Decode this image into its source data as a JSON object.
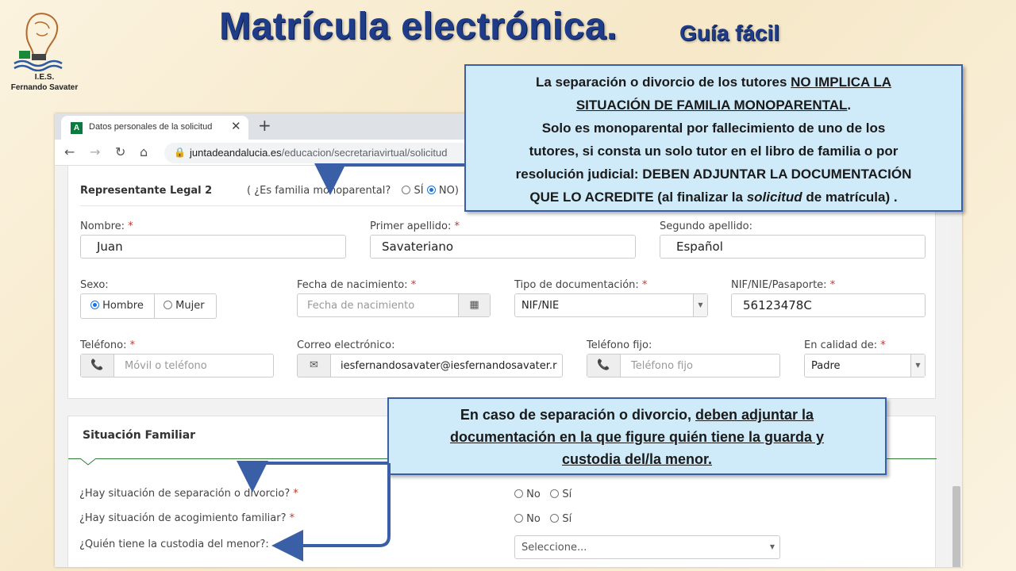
{
  "header": {
    "title": "Matrícula electrónica.",
    "subtitle": "Guía fácil",
    "logo_line1": "I.E.S.",
    "logo_line2": "Fernando Savater"
  },
  "browser": {
    "tab_title": "Datos personales de la solicitud",
    "favicon_letter": "A",
    "url_host": "juntadeandalucia.es",
    "url_path": "/educacion/secretariavirtual/solicitud"
  },
  "representante": {
    "section_title": "Representante Legal 2",
    "monoparental_question_open": "( ¿Es familia monoparental?",
    "opt_si": "SÍ",
    "opt_no": "NO)",
    "selected": "NO",
    "nombre_label": "Nombre:",
    "nombre_value": "Juan",
    "apellido1_label": "Primer apellido:",
    "apellido1_value": "Savateriano",
    "apellido2_label": "Segundo apellido:",
    "apellido2_value": "Español",
    "sexo_label": "Sexo:",
    "sexo_hombre": "Hombre",
    "sexo_mujer": "Mujer",
    "sexo_selected": "Hombre",
    "fecha_label": "Fecha de nacimiento:",
    "fecha_placeholder": "Fecha de nacimiento",
    "tipodoc_label": "Tipo de documentación:",
    "tipodoc_value": "NIF/NIE",
    "nif_label": "NIF/NIE/Pasaporte:",
    "nif_value": "56123478C",
    "telefono_label": "Teléfono:",
    "telefono_placeholder": "Móvil o teléfono",
    "correo_label": "Correo electrónico:",
    "correo_value": "iesfernandosavater@iesfernandosavater.r",
    "tfijo_label": "Teléfono fijo:",
    "tfijo_placeholder": "Teléfono fijo",
    "calidad_label": "En calidad de:",
    "calidad_value": "Padre",
    "required_mark": "*"
  },
  "situacion": {
    "section_title": "Situación Familiar",
    "q_separacion": "¿Hay situación de separación o divorcio?",
    "q_acogimiento": "¿Hay situación de acogimiento familiar?",
    "q_custodia": "¿Quién tiene la custodia del menor?:",
    "opt_no": "No",
    "opt_si": "Sí",
    "custodia_placeholder": "Seleccione..."
  },
  "callout1": {
    "l1a": "La separación o divorcio de los tutores ",
    "l1b": "NO IMPLICA LA",
    "l2a": "SITUACIÓN DE FAMILIA MONOPARENTAL",
    "l2b": ".",
    "l3": "Solo es monoparental por fallecimiento de uno de los",
    "l4": "tutores, si consta un solo tutor en el libro de familia o por",
    "l5": "resolución judicial: DEBEN ADJUNTAR LA DOCUMENTACIÓN",
    "l6a": "QUE LO ACREDITE (al finalizar la ",
    "l6b": "solicitud",
    "l6c": " de matrícula)  ."
  },
  "callout2": {
    "l1a": "En caso de separación o divorcio, ",
    "l1b": "deben adjuntar la",
    "l2": "documentación en la que figure quién tiene la guarda y",
    "l3": "custodia del/la menor."
  },
  "icons": {
    "close": "✕",
    "new_tab": "+",
    "back": "←",
    "forward": "→",
    "reload": "↻",
    "home": "⌂",
    "lock": "🔒",
    "phone": "📞",
    "mail": "✉",
    "calendar": "▦",
    "dropdown": "▼"
  },
  "colors": {
    "title": "#1f3c88",
    "callout_bg": "#cfeaf8",
    "callout_border": "#3b5fa6",
    "section_accent": "#2e7d32"
  }
}
